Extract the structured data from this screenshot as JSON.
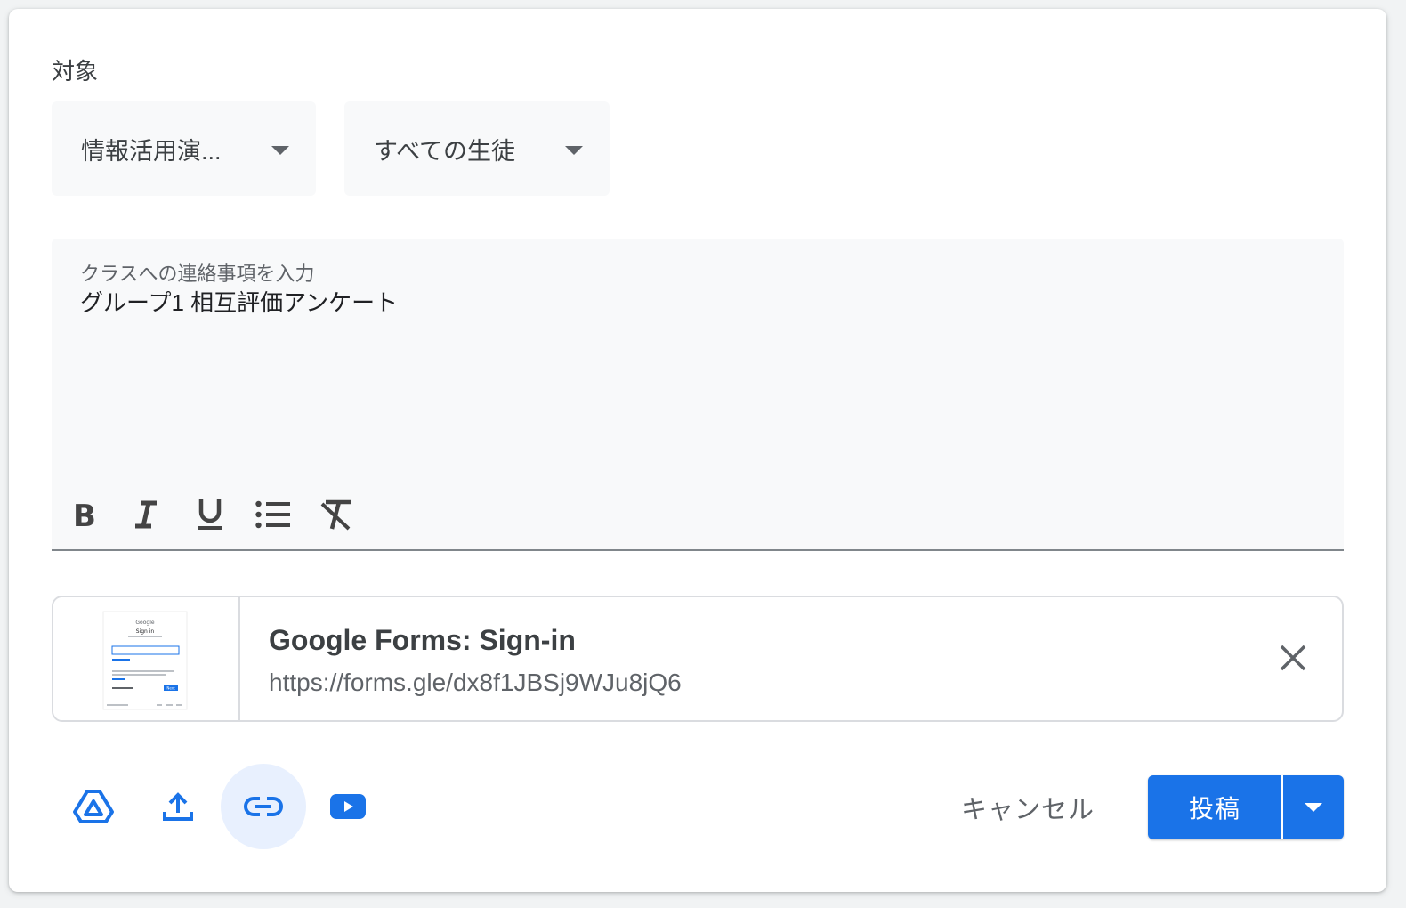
{
  "target": {
    "label": "対象",
    "class_select": "情報活用演...",
    "student_select": "すべての生徒"
  },
  "editor": {
    "placeholder": "クラスへの連絡事項を入力",
    "text": "グループ1 相互評価アンケート",
    "toolbar": [
      "bold-icon",
      "italic-icon",
      "underline-icon",
      "bulleted-list-icon",
      "clear-formatting-icon"
    ]
  },
  "attachment": {
    "title": "Google Forms: Sign-in",
    "url": "https://forms.gle/dx8f1JBSj9WJu8jQ6",
    "thumbnail": {
      "brand": "Google",
      "heading": "Sign in",
      "next_button": "Next"
    }
  },
  "add_tools": [
    "google-drive-icon",
    "upload-icon",
    "link-icon",
    "youtube-icon"
  ],
  "actions": {
    "cancel": "キャンセル",
    "post": "投稿"
  },
  "colors": {
    "accent": "#1a73e8",
    "active_tool_bg": "#e8f0fe",
    "field_bg": "#f8f9fa"
  }
}
